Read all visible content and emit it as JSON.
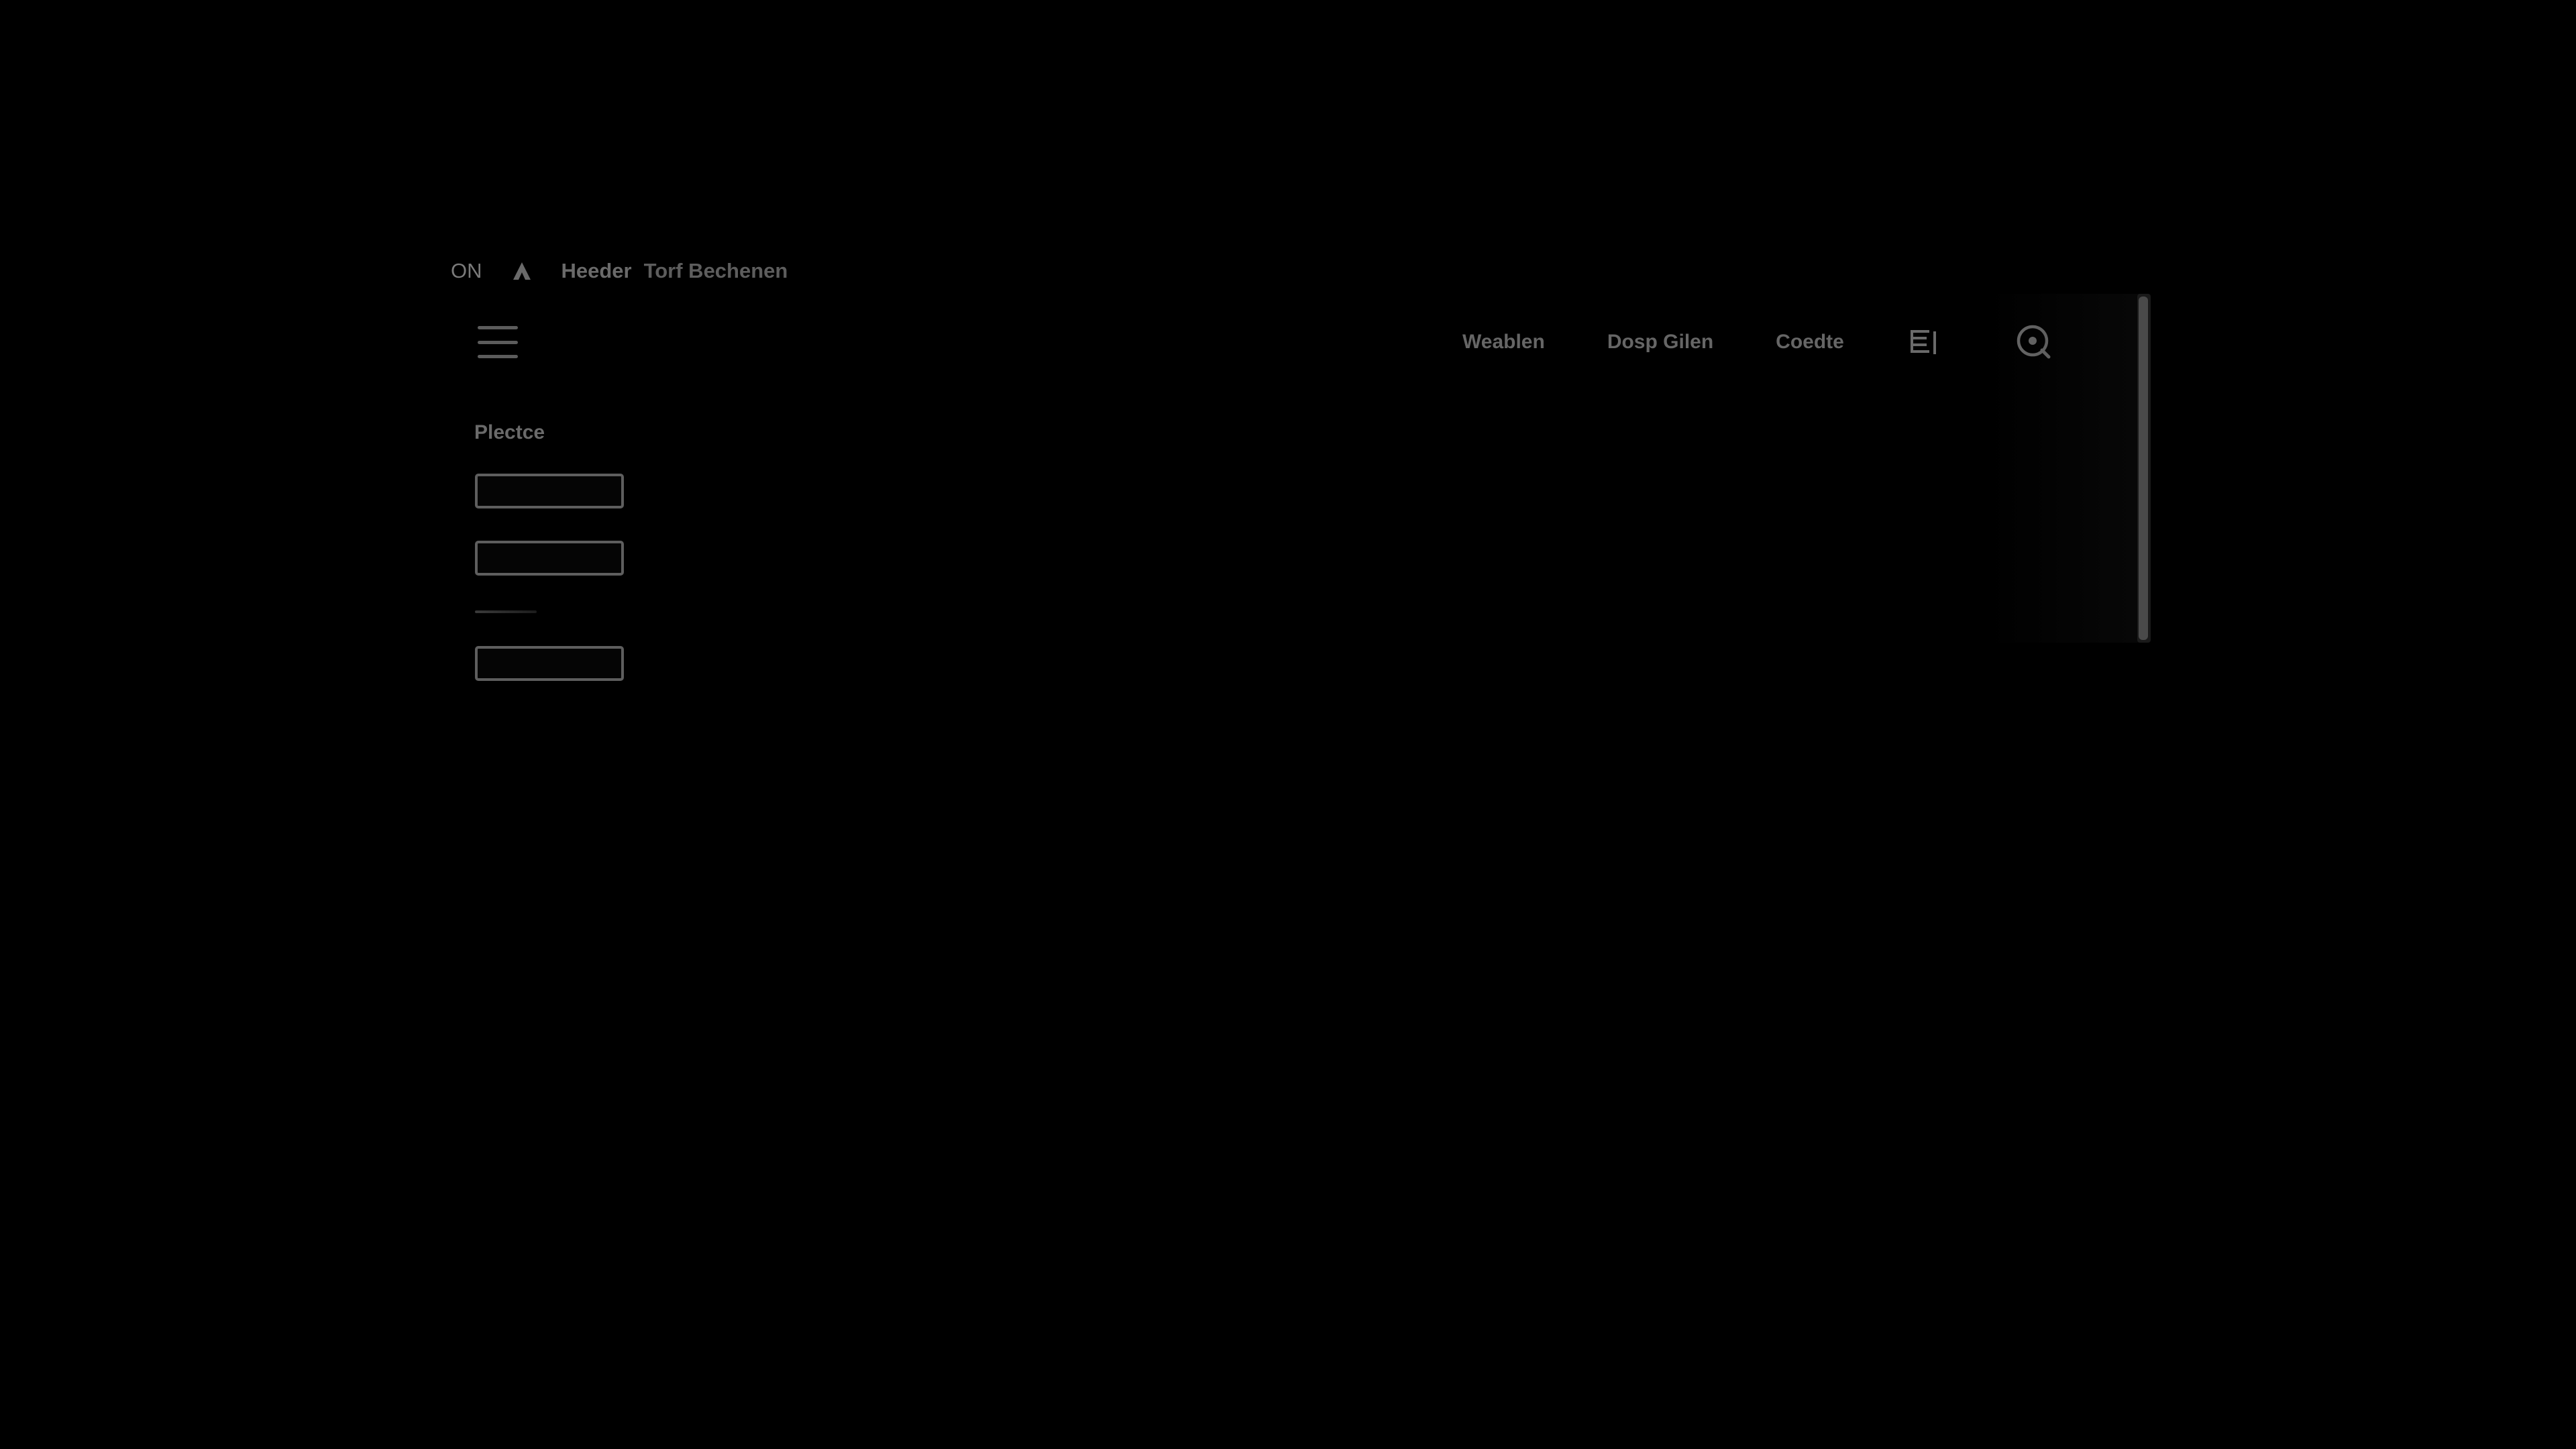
{
  "status": {
    "indicator": "ON",
    "home_icon": "home-arrow-icon"
  },
  "breadcrumb": {
    "items": [
      "Heeder",
      "Torf Bechenen"
    ]
  },
  "header": {
    "menu_icon": "hamburger-menu-icon",
    "nav": [
      "Weablen",
      "Dosp Gilen",
      "Coedte"
    ],
    "list_icon": "list-document-icon",
    "search_icon": "search-icon"
  },
  "sidebar": {
    "section_label": "Plectce",
    "fields": [
      {
        "value": "",
        "placeholder": ""
      },
      {
        "value": "",
        "placeholder": ""
      },
      {
        "value": "",
        "placeholder": ""
      }
    ]
  },
  "colors": {
    "background": "#000000",
    "text": "#6a6a6a",
    "border": "#5e5e5e",
    "scrollbar": "#4a4a4a"
  }
}
